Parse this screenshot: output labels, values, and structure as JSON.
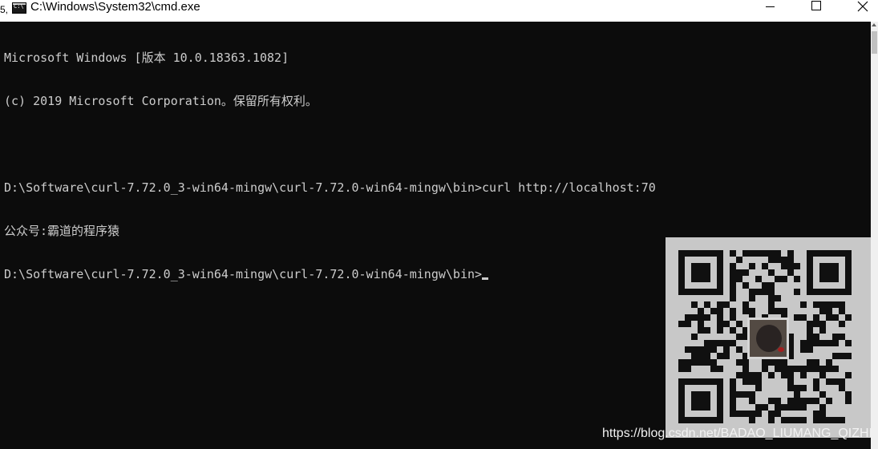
{
  "window": {
    "title_stub": "5,",
    "title": "C:\\Windows\\System32\\cmd.exe",
    "icon": "cmd-icon",
    "controls": {
      "minimize": "minimize-icon",
      "maximize": "maximize-icon",
      "close": "close-icon"
    }
  },
  "console": {
    "lines": [
      "Microsoft Windows [版本 10.0.18363.1082]",
      "(c) 2019 Microsoft Corporation。保留所有权利。",
      "",
      "D:\\Software\\curl-7.72.0_3-win64-mingw\\curl-7.72.0-win64-mingw\\bin>curl http://localhost:70",
      "公众号:霸道的程序猿",
      "D:\\Software\\curl-7.72.0_3-win64-mingw\\curl-7.72.0-win64-mingw\\bin>"
    ],
    "background_color": "#0c0c0c",
    "text_color": "#cccccc"
  },
  "watermark": {
    "url": "https://blog.csdn.net/BADAO_LIUMANG_QIZHI"
  }
}
